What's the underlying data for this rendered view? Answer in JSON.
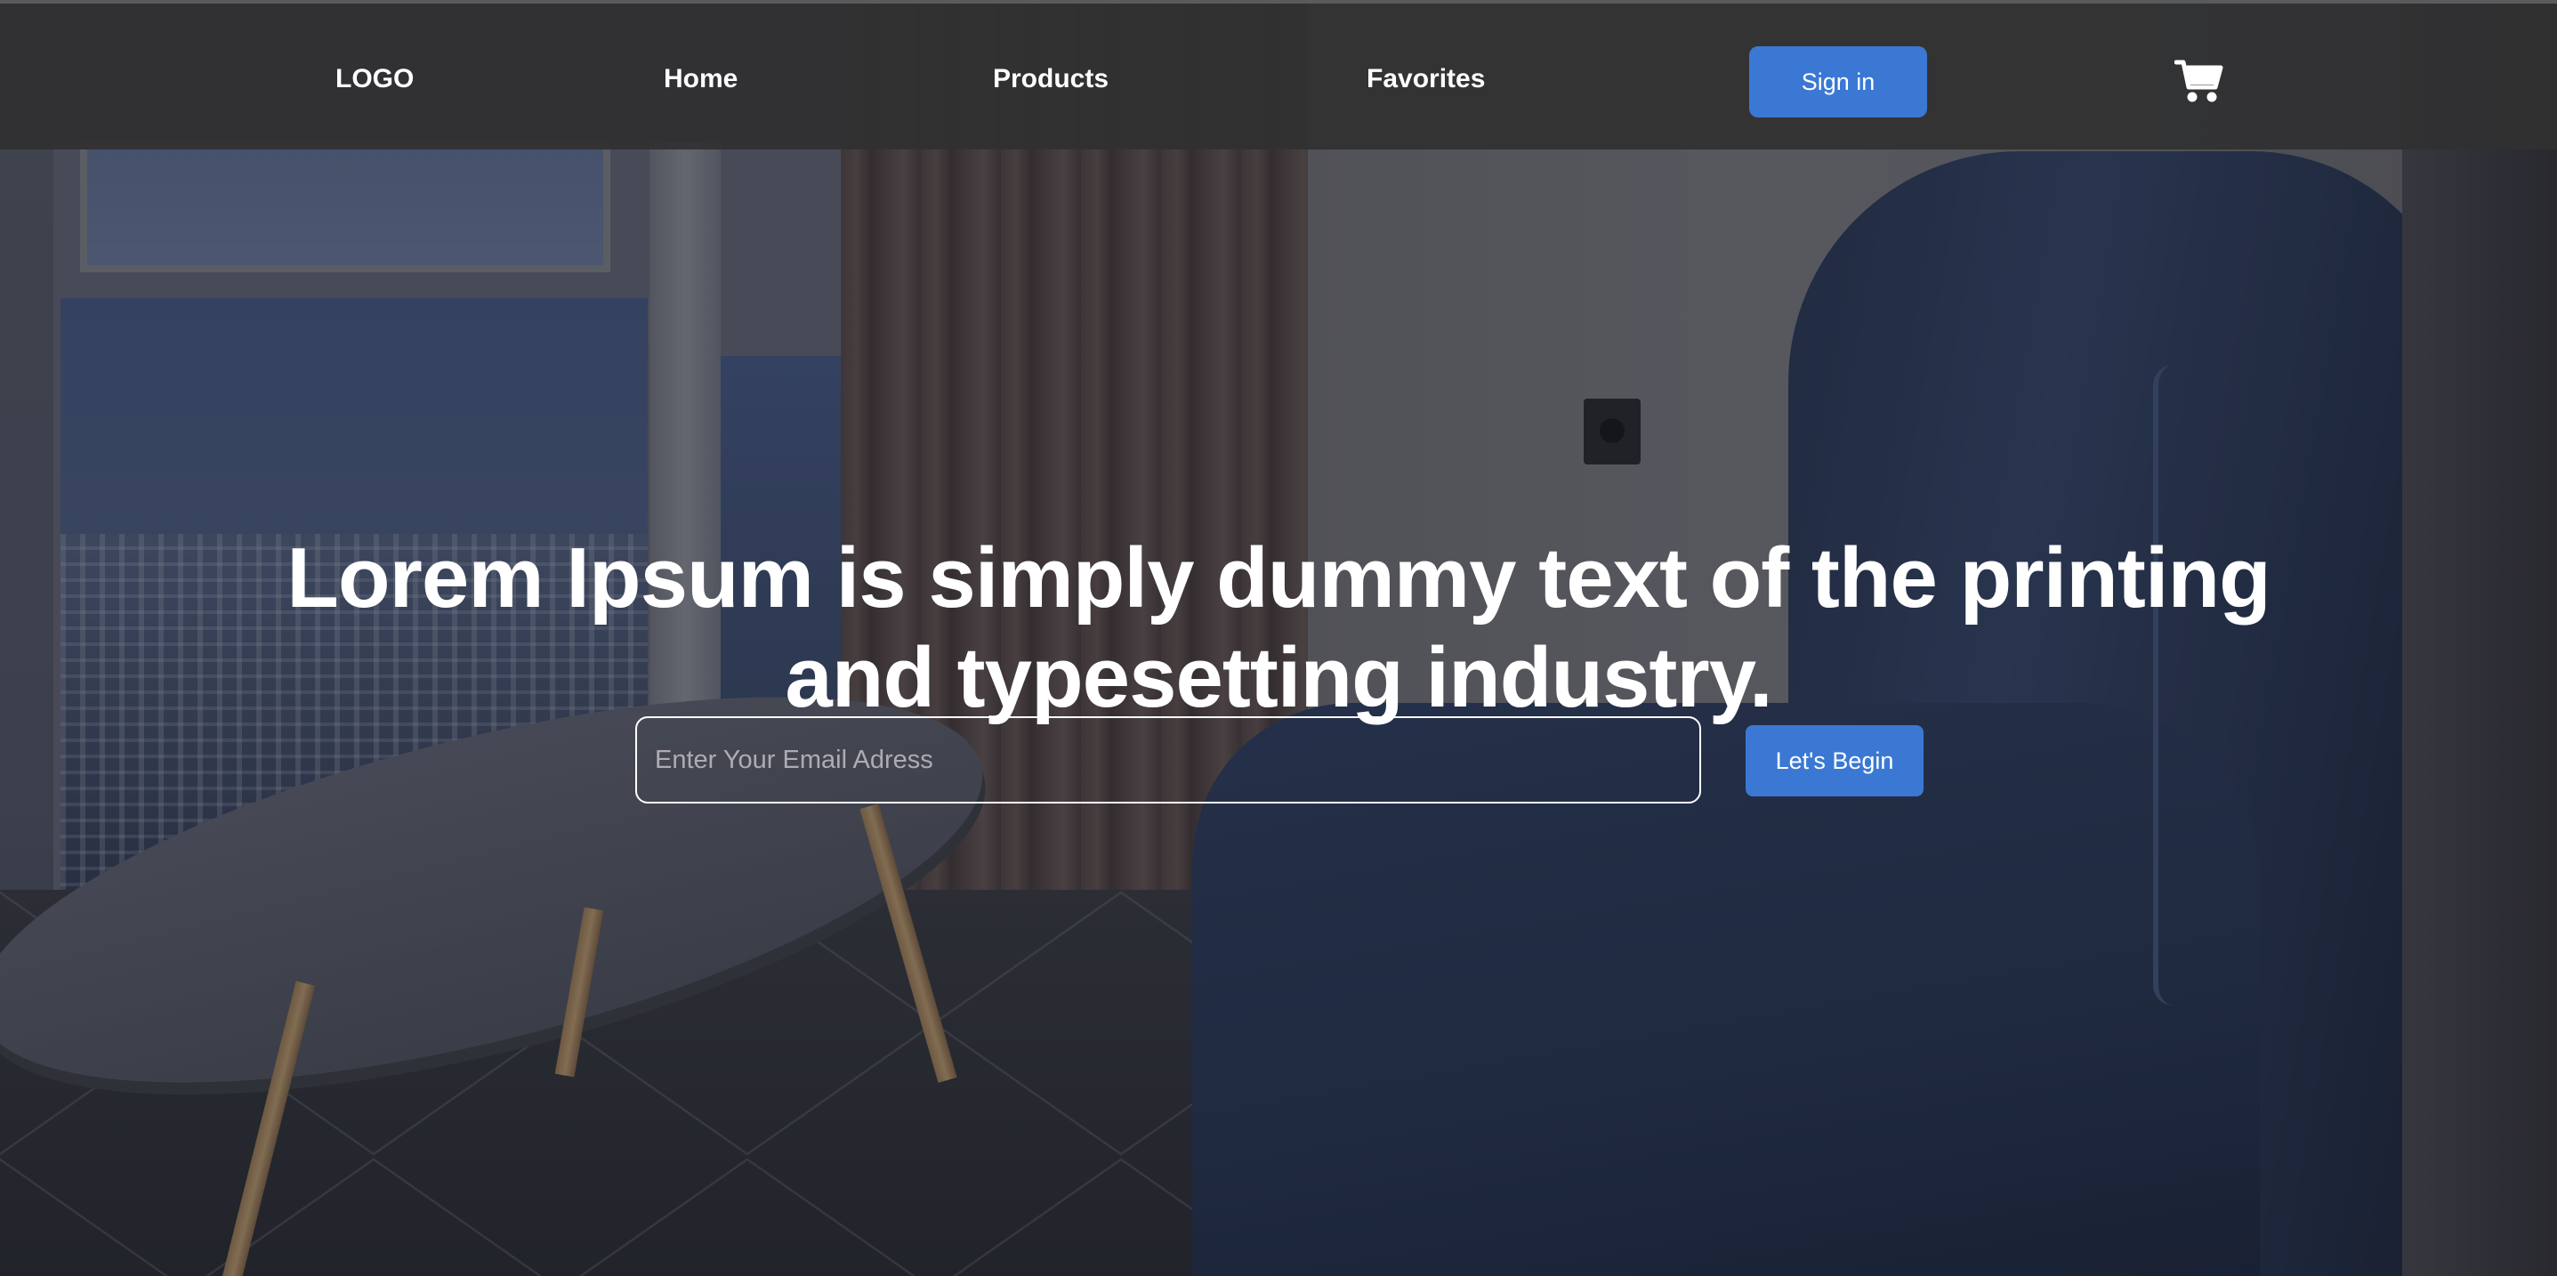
{
  "nav": {
    "logo": "LOGO",
    "links": [
      "Home",
      "Products",
      "Favorites"
    ],
    "signin_label": "Sign in",
    "cart_icon": "shopping-cart-icon"
  },
  "hero": {
    "title_line1": "Lorem Ipsum is simply dummy text of the printing",
    "title_line2": "and typesetting industry.",
    "email_placeholder": "Enter Your Email Adress",
    "email_value": "",
    "cta_label": "Let's Begin"
  },
  "colors": {
    "accent": "#3b78d4",
    "nav_bg": "#303032",
    "text": "#ffffff"
  }
}
